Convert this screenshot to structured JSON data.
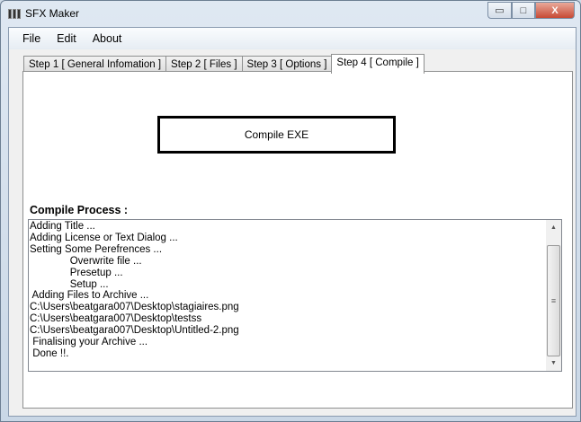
{
  "window": {
    "title": "SFX Maker",
    "minimize": "▭",
    "maximize": "□",
    "close": "X"
  },
  "menu": [
    "File",
    "Edit",
    "About"
  ],
  "tabs": [
    "Step 1 [ General Infomation ]",
    "Step 2 [ Files ]",
    "Step 3 [ Options ]",
    "Step 4 [ Compile ]"
  ],
  "active_tab": 3,
  "compile_button": "Compile EXE",
  "process_label": "Compile Process :",
  "log_lines": [
    "Adding Title ...",
    "Adding License or Text Dialog ...",
    "Setting Some Perefrences ...",
    "              Overwrite file ...",
    "              Presetup ...",
    "              Setup ...",
    " Adding Files to Archive ...",
    "C:\\Users\\beatgara007\\Desktop\\stagiaires.png",
    "C:\\Users\\beatgara007\\Desktop\\testss",
    "C:\\Users\\beatgara007\\Desktop\\Untitled-2.png",
    " Finalising your Archive ...",
    " Done !!."
  ],
  "scrollbar": {
    "up": "▲",
    "down": "▼",
    "grip": "≡"
  }
}
